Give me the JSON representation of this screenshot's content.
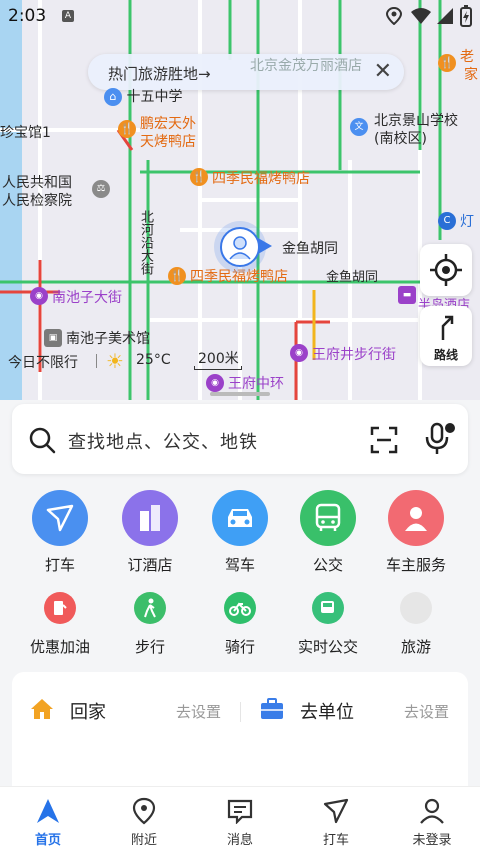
{
  "status_bar": {
    "time": "2:03",
    "sim_icon": "A"
  },
  "map": {
    "banner": {
      "text": "热门旅游胜地→"
    },
    "labels": {
      "bj_hotel": "北京金茂万丽酒店",
      "shiwu": "十五中学",
      "pengHong": "鹏宏天外",
      "pengHong2": "天烤鸭店",
      "bj_jingshan": "北京景山学校",
      "bj_jingshan2": "(南校区)",
      "zhenbaoguan": "珍宝馆1",
      "renmin_gonghe": "人民共和国",
      "renmin_jiancha": "人民检察院",
      "siji_1": "四季民福烤鸭店",
      "beihe_yanstreet": "北河沿大街",
      "jinyu_1": "金鱼胡同",
      "siji_2": "四季民福烤鸭店",
      "jinyu_2": "金鱼胡同",
      "nanchizi": "南池子大街",
      "bandao": "半岛酒店",
      "nanchizi_mei": "南池子美术馆",
      "wangfujing_walk": "王府井步行街",
      "wangfujing_center": "王府中环",
      "laozi": "老",
      "jia": "家",
      "deng": "灯"
    },
    "no_limit": "今日不限行",
    "weather": "25°C",
    "scale": "200米",
    "route_label": "路线",
    "colors": {
      "road_green": "#3cc46b",
      "road_red": "#e5453d",
      "road_yellow": "#f2b51d"
    }
  },
  "search": {
    "placeholder": "查找地点、公交、地铁"
  },
  "quick_actions": [
    {
      "label": "打车",
      "color": "#4a90f0",
      "icon": "taxi-icon"
    },
    {
      "label": "订酒店",
      "color": "#8b72ea",
      "icon": "hotel-icon"
    },
    {
      "label": "驾车",
      "color": "#3f9ff5",
      "icon": "car-icon"
    },
    {
      "label": "公交",
      "color": "#39c06a",
      "icon": "bus-icon"
    },
    {
      "label": "车主服务",
      "color": "#f26a72",
      "icon": "car-owner-icon"
    }
  ],
  "secondary_actions": [
    {
      "label": "优惠加油",
      "color": "#f05a5a",
      "icon": "gas-icon"
    },
    {
      "label": "步行",
      "color": "#3cbe6a",
      "icon": "walk-icon"
    },
    {
      "label": "骑行",
      "color": "#2fbf6b",
      "icon": "bike-icon"
    },
    {
      "label": "实时公交",
      "color": "#37c07a",
      "icon": "realtime-bus-icon"
    },
    {
      "label": "旅游",
      "color": "#e6e6e6",
      "icon": "travel-icon"
    }
  ],
  "commute": {
    "home": {
      "label": "回家",
      "action": "去设置"
    },
    "work": {
      "label": "去单位",
      "action": "去设置"
    }
  },
  "tabs": [
    {
      "label": "首页",
      "active": true
    },
    {
      "label": "附近",
      "active": false
    },
    {
      "label": "消息",
      "active": false
    },
    {
      "label": "打车",
      "active": false
    },
    {
      "label": "未登录",
      "active": false
    }
  ]
}
